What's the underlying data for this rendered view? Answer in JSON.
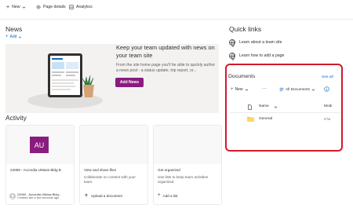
{
  "command_bar": {
    "new_label": "New",
    "page_details_label": "Page details",
    "analytics_label": "Analytics"
  },
  "news": {
    "title": "News",
    "add_label": "Add",
    "headline": "Keep your team updated with news on your team site",
    "body": "From the site home page you'll be able to quickly author a news post - a status update, trip report, or...",
    "button_label": "Add News"
  },
  "quick_links": {
    "title": "Quick links",
    "items": [
      {
        "label": "Learn about a team site",
        "icon": "globe-icon"
      },
      {
        "label": "Learn how to add a page",
        "icon": "globe-icon"
      }
    ]
  },
  "documents": {
    "title": "Documents",
    "see_all_label": "See all",
    "new_label": "New",
    "more_label": "···",
    "view_label": "All Documents",
    "columns": {
      "name": "Name",
      "modified": "Modi"
    },
    "rows": [
      {
        "name": "General",
        "modified": "4 ho"
      }
    ]
  },
  "activity": {
    "title": "Activity",
    "cards": [
      {
        "avatar_initials": "AU",
        "title": "24069 - Accordia UMass Bldg B",
        "owner": "24069 - Accordia UMass Bldg...",
        "subtitle": "Created site a few seconds ago"
      },
      {
        "title": "View and share files",
        "description": "Collaborate on content with your team.",
        "action": "Upload a document"
      },
      {
        "title": "Get organized",
        "description": "Use lists to keep team activities organized.",
        "action": "Add a list"
      }
    ]
  },
  "colors": {
    "accent": "#8a1b7f",
    "link": "#0f6cbd",
    "highlight": "#d11a2a"
  }
}
